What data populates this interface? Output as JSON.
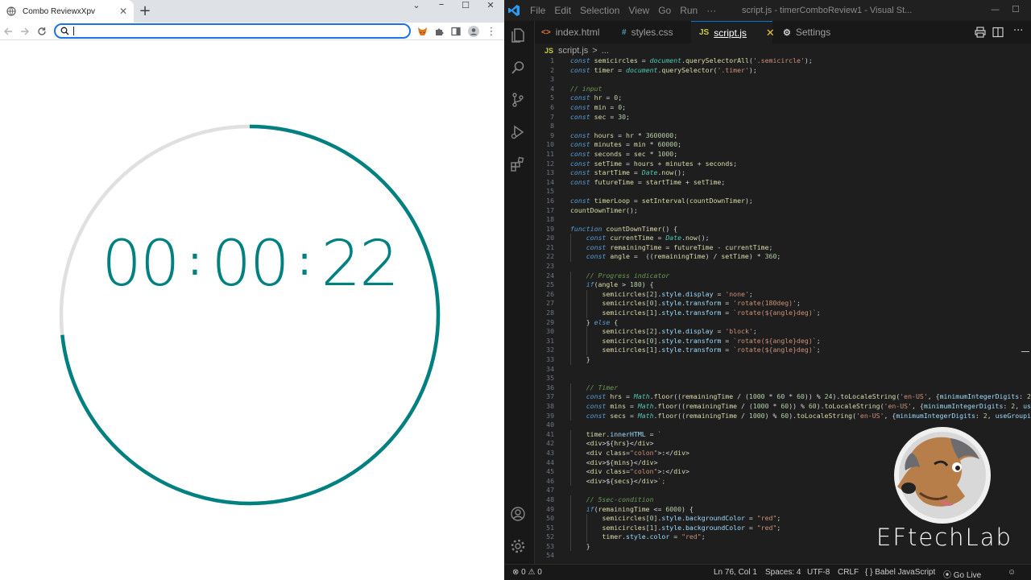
{
  "browser": {
    "tab_title": "Combo ReviewxXpv",
    "tab_close": "✕",
    "new_tab": "+",
    "omnibox_placeholder": "",
    "timer": {
      "hours": "00",
      "minutes": "00",
      "seconds": "22",
      "separator": ":",
      "progress_fraction": 0.733,
      "track_color": "#e0e0e0",
      "progress_color": "#008080"
    }
  },
  "vscode": {
    "menu": [
      "File",
      "Edit",
      "Selection",
      "View",
      "Go",
      "Run",
      "···"
    ],
    "window_title": "script.js - timerComboReview1 - Visual St...",
    "tabs": [
      {
        "icon": "<>",
        "label": "index.html"
      },
      {
        "icon": "#",
        "label": "styles.css"
      },
      {
        "icon": "JS",
        "label": "script.js",
        "active": true
      },
      {
        "icon": "⚙",
        "label": "Settings"
      }
    ],
    "breadcrumb": {
      "file": "script.js",
      "sep": ">",
      "rest": "..."
    },
    "accent_color": "#0078d4",
    "code_lines": [
      "const semicircles = document.querySelectorAll('.semicircle');",
      "const timer = document.querySelector('.timer');",
      "",
      "// input",
      "const hr = 0;",
      "const min = 0;",
      "const sec = 30;",
      "",
      "const hours = hr * 3600000;",
      "const minutes = min * 60000;",
      "const seconds = sec * 1000;",
      "const setTime = hours + minutes + seconds;",
      "const startTime = Date.now();",
      "const futureTime = startTime + setTime;",
      "",
      "const timerLoop = setInterval(countDownTimer);",
      "countDownTimer();",
      "",
      "function countDownTimer() {",
      "    const currentTime = Date.now();",
      "    const remainingTime = futureTime - currentTime;",
      "    const angle =  ((remainingTime) / setTime) * 360;",
      "",
      "    // Progress indicator",
      "    if(angle > 180) {",
      "        semicircles[2].style.display = 'none';",
      "        semicircles[0].style.transform = 'rotate(180deg)';",
      "        semicircles[1].style.transform = `rotate(${angle}deg)`;",
      "    } else {",
      "        semicircles[2].style.display = 'block';",
      "        semicircles[0].style.transform = `rotate(${angle}deg)`;",
      "        semicircles[1].style.transform = `rotate(${angle}deg)`;",
      "    }",
      "",
      "",
      "    // Timer",
      "    const hrs = Math.floor((remainingTime / (1000 * 60 * 60)) % 24).toLocaleString('en-US', {minimumIntegerDigits: 2, useGrouping",
      "    const mins = Math.floor((remainingTime / (1000 * 60)) % 60).toLocaleString('en-US', {minimumIntegerDigits: 2, useGrouping:fa",
      "    const secs = Math.floor((remainingTime / 1000) % 60).toLocaleString('en-US', {minimumIntegerDigits: 2, useGrouping:false});",
      "",
      "    timer.innerHTML = `",
      "    <div>${hrs}</div>",
      "    <div class=\"colon\">:</div>",
      "    <div>${mins}</div>",
      "    <div class=\"colon\">:</div>",
      "    <div>${secs}</div>`;",
      "",
      "    // 5sec-condition",
      "    if(remainingTime <= 6000) {",
      "        semicircles[0].style.backgroundColor = \"red\";",
      "        semicircles[1].style.backgroundColor = \"red\";",
      "        timer.style.color = \"red\";",
      "    }",
      ""
    ],
    "status": {
      "errors": "⊗ 0 ⚠ 0",
      "position": "Ln 76, Col 1",
      "spaces": "Spaces: 4",
      "encoding": "UTF-8",
      "eol": "CRLF",
      "language": "{ }  Babel JavaScript",
      "golive": "⦿ Go Live"
    }
  },
  "watermark": {
    "text": "EFtechLab"
  }
}
